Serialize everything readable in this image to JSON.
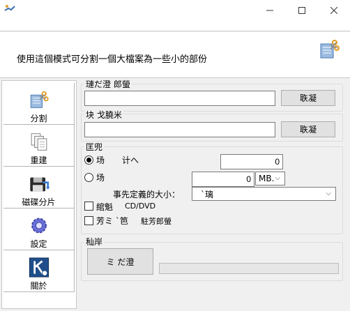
{
  "window": {
    "icons": {
      "app": "split-file-icon",
      "minimize": "minimize-icon",
      "maximize": "maximize-icon",
      "close": "close-icon"
    }
  },
  "header": {
    "description": "使用這個模式可分割一個大檔案為一些小的部份",
    "icon": "split-file-icon"
  },
  "sidebar": {
    "items": [
      {
        "label": "分割",
        "icon": "split-icon"
      },
      {
        "label": "重建",
        "icon": "rebuild-icon"
      },
      {
        "label": "磁碟分片",
        "icon": "floppy-icon"
      },
      {
        "label": "設定",
        "icon": "gear-icon"
      },
      {
        "label": "關於",
        "icon": "about-k-icon"
      }
    ]
  },
  "source_group": {
    "title": "璉だ澄  郎螢",
    "path_value": "",
    "browse_label": "聅凝"
  },
  "dest_group": {
    "title": "块  戈膮米",
    "path_value": "",
    "browse_label": "聅凝"
  },
  "options_group": {
    "title": "匡兜",
    "option_count": {
      "label": "场",
      "sub_label": "计へ",
      "value": "0",
      "selected": true
    },
    "option_size": {
      "label": "场",
      "value": "0",
      "unit": "MB.",
      "selected": false
    },
    "predefined": {
      "label": "事先定義的大小：",
      "value": "`璃"
    },
    "cd_dvd": {
      "label": "綰魁",
      "sub_label": "CD/DVD",
      "checked": false
    },
    "batch": {
      "label": "芳ミ `笆",
      "sub_label": "駐芳郎螢",
      "checked": false
    }
  },
  "progress_group": {
    "title": "秈岸",
    "start_label": "ミ  だ澄",
    "progress": 0
  }
}
